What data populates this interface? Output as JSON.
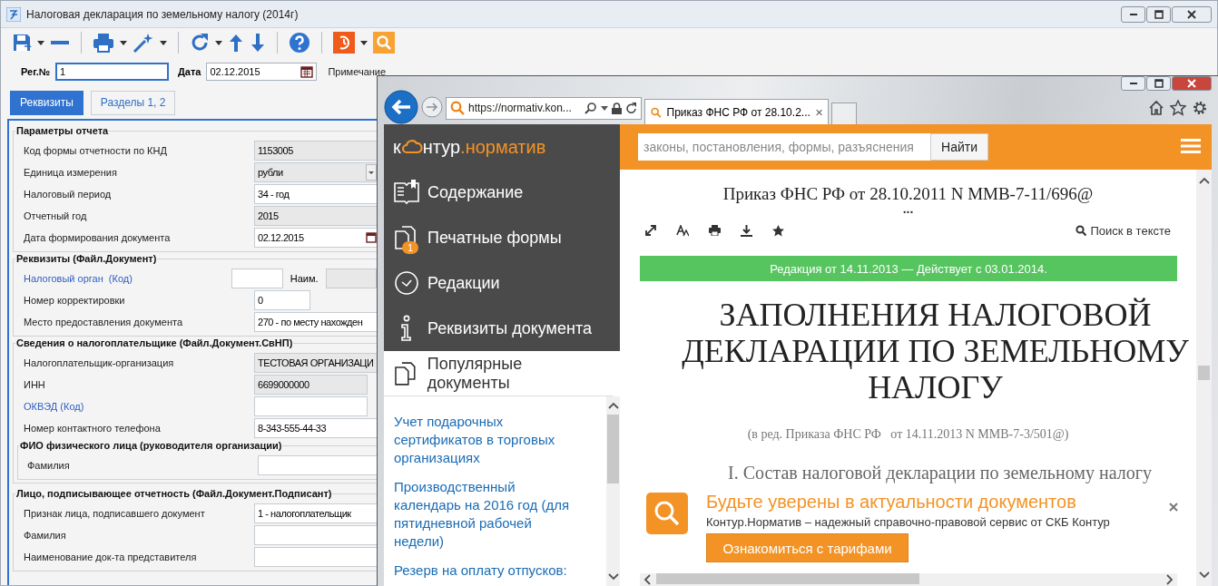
{
  "app": {
    "title": "Налоговая декларация по земельному налогу (2014г)",
    "header_fields": [
      {
        "label": "Рег.№",
        "value": "1",
        "kind": "text",
        "focused": true
      },
      {
        "label": "Дата",
        "value": "02.12.2015",
        "kind": "date",
        "focused": false
      }
    ],
    "note_label": "Примечание",
    "tabs": [
      {
        "label": "Реквизиты",
        "selected": true
      },
      {
        "label": "Разделы 1, 2",
        "selected": false
      }
    ],
    "groups": [
      {
        "title": "Параметры отчета",
        "rows": [
          {
            "label": "Код формы отчетности по КНД",
            "value": "1153005",
            "kind": "text",
            "disabled": true,
            "link": false
          },
          {
            "label": "Единица измерения",
            "value": "рубли",
            "kind": "combo",
            "disabled": true,
            "link": false
          },
          {
            "label": "Налоговый период",
            "value": "34 - год",
            "kind": "text",
            "disabled": false,
            "link": false
          },
          {
            "label": "Отчетный год",
            "value": "2015",
            "kind": "text",
            "disabled": true,
            "link": false
          },
          {
            "label": "Дата формирования документа",
            "value": "02.12.2015",
            "kind": "date",
            "disabled": false,
            "link": false
          }
        ]
      },
      {
        "title": "Реквизиты (Файл.Документ)",
        "rows": [
          {
            "label": "Налоговый орган  (Код)",
            "kind": "code",
            "name_label": "Наим.",
            "disabled": false,
            "link": true
          },
          {
            "label": "Номер корректировки",
            "value": "0",
            "kind": "short",
            "disabled": false,
            "link": false
          },
          {
            "label": "Место предоставления документа",
            "value": "270 - по месту нахожден",
            "kind": "text",
            "disabled": false,
            "link": false
          }
        ]
      },
      {
        "title": "Сведения о налогоплательщике (Файл.Документ.СвНП)",
        "rows": [
          {
            "label": "Налогоплательщик-организация",
            "value": "ТЕСТОВАЯ ОРГАНИЗАЦИ",
            "kind": "text",
            "disabled": true,
            "link": false
          },
          {
            "label": "ИНН",
            "value": "6699000000",
            "kind": "medium",
            "disabled": true,
            "link": false
          },
          {
            "label": "ОКВЭД (Код)",
            "kind": "medium",
            "disabled": false,
            "link": true
          },
          {
            "label": "Номер контактного телефона",
            "value": "8-343-555-44-33",
            "kind": "text",
            "disabled": false,
            "link": false
          }
        ],
        "children": [
          {
            "title": "ФИО физического лица (руководителя организации)",
            "rows": [
              {
                "label": "Фамилия",
                "kind": "text",
                "disabled": false,
                "link": false
              }
            ]
          }
        ]
      },
      {
        "title": "Лицо, подписывающее отчетность (Файл.Документ.Подписант)",
        "rows": [
          {
            "label": "Признак лица, подписавшего документ",
            "value": "1 - налогоплательщик",
            "kind": "text",
            "disabled": false,
            "link": false
          },
          {
            "label": "Фамилия",
            "kind": "text",
            "disabled": false,
            "link": false
          },
          {
            "label": "Наименование док-та представителя",
            "kind": "text",
            "disabled": false,
            "link": false
          }
        ]
      }
    ]
  },
  "browser": {
    "address": "https://normativ.kon...",
    "tabs": [
      {
        "title": "Приказ ФНС РФ от 28.10.2...",
        "selected": true
      }
    ],
    "site": {
      "logo": {
        "prefix": "к",
        "main": "нтур",
        "suffix": ".норматив"
      },
      "search": {
        "placeholder": "законы, постановления, формы, разъяснения"
      },
      "search_button": "Найти",
      "sidebar": [
        {
          "label": "Содержание",
          "kind": "contents",
          "selected": false
        },
        {
          "label": "Печатные формы",
          "kind": "forms",
          "badge": "1",
          "selected": false
        },
        {
          "label": "Редакции",
          "kind": "editions",
          "selected": false
        },
        {
          "label": "Реквизиты документа",
          "kind": "info",
          "selected": false
        },
        {
          "label": "Популярные документы",
          "kind": "popular",
          "selected": true
        }
      ],
      "popular_links": [
        "Учет подарочных сертификатов в торговых организациях",
        "Производственный календарь на 2016 год (для пятидневной рабочей недели)",
        "Резерв на оплату отпусков:"
      ],
      "document": {
        "title": "Приказ ФНС РФ от 28.10.2011 N ММВ-7-11/696@",
        "more": "...",
        "search_label": "Поиск в тексте",
        "edition": "Редакция от 14.11.2013 — Действует с 03.01.2014.",
        "heading": [
          "ЗАПОЛНЕНИЯ НАЛОГОВОЙ",
          "ДЕКЛАРАЦИИ ПО ЗЕМЕЛЬНОМУ",
          "НАЛОГУ"
        ],
        "subtitle": "(в ред. Приказа ФНС РФ   от 14.11.2013 N ММВ-7-3/501@)",
        "section": "I. Состав налоговой декларации по земельному налогу"
      },
      "promo": {
        "title": "Будьте уверены в актуальности документов",
        "text": "Контур.Норматив – надежный справочно-правовой сервис от СКБ Контур",
        "button": "Ознакомиться с тарифами"
      }
    }
  }
}
